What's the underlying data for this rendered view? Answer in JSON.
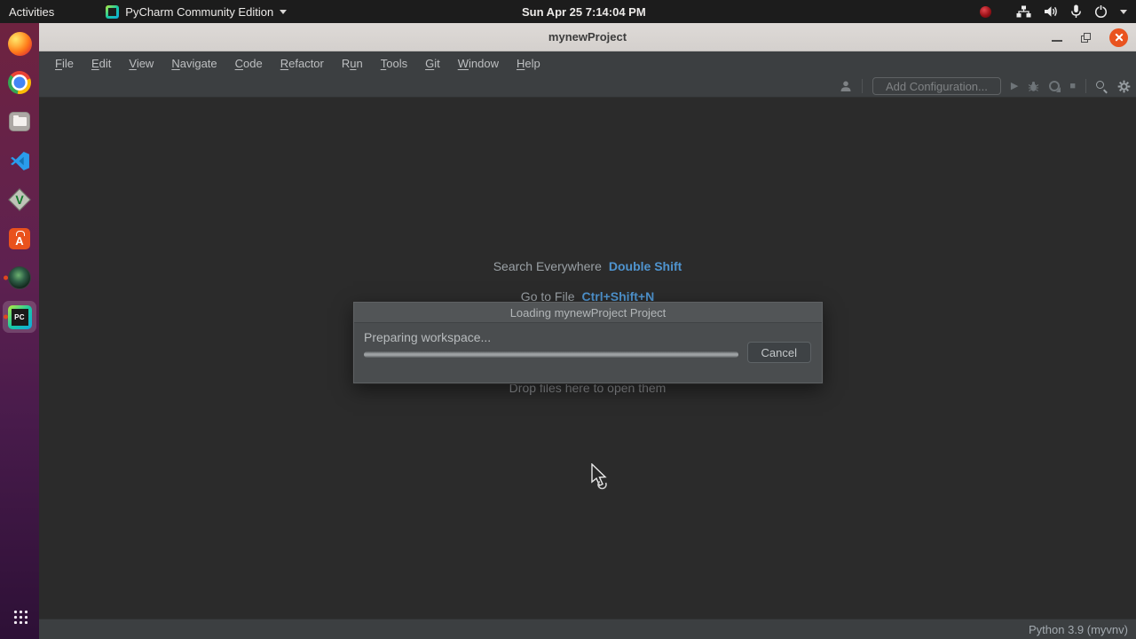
{
  "topbar": {
    "activities": "Activities",
    "app_name": "PyCharm Community Edition",
    "clock": "Sun Apr 25  7:14:04 PM"
  },
  "window": {
    "title": "mynewProject"
  },
  "menubar": {
    "items": [
      {
        "label": "File",
        "mnemonic": 0
      },
      {
        "label": "Edit",
        "mnemonic": 0
      },
      {
        "label": "View",
        "mnemonic": 0
      },
      {
        "label": "Navigate",
        "mnemonic": 0
      },
      {
        "label": "Code",
        "mnemonic": 0
      },
      {
        "label": "Refactor",
        "mnemonic": 0
      },
      {
        "label": "Run",
        "mnemonic": 1
      },
      {
        "label": "Tools",
        "mnemonic": 0
      },
      {
        "label": "Git",
        "mnemonic": 0
      },
      {
        "label": "Window",
        "mnemonic": 0
      },
      {
        "label": "Help",
        "mnemonic": 0
      }
    ]
  },
  "toolbar": {
    "add_configuration": "Add Configuration..."
  },
  "hints": {
    "search_label": "Search Everywhere",
    "search_shortcut": "Double Shift",
    "goto_label": "Go to File",
    "goto_shortcut": "Ctrl+Shift+N",
    "drop_label": "Drop files here to open them"
  },
  "dialog": {
    "title": "Loading mynewProject Project",
    "message": "Preparing workspace...",
    "cancel_label": "Cancel",
    "progress": {
      "indeterminate": true
    }
  },
  "statusbar": {
    "interpreter": "Python 3.9 (myvnv)"
  },
  "dock": {
    "items": [
      "firefox",
      "chrome",
      "files",
      "vscode",
      "vim",
      "ubuntu-software",
      "screen-recorder",
      "pycharm",
      "show-applications"
    ],
    "running": [
      "screen-recorder",
      "pycharm"
    ],
    "active": "pycharm",
    "pycharm_badge": "PC"
  },
  "icons": {
    "tray": [
      "recording-indicator",
      "network",
      "volume",
      "microphone",
      "power",
      "menu-caret"
    ],
    "toolbar": [
      "user",
      "add-configuration",
      "run-play",
      "debug-bug",
      "profiler",
      "stop-square",
      "search-magnifier",
      "settings-gear"
    ],
    "window_controls": [
      "minimize",
      "maximize-restore",
      "close"
    ]
  },
  "colors": {
    "close_button": "#e9531f",
    "shortcut_blue": "#4f94cf",
    "panel_bg": "#3c3f41",
    "editor_bg": "#2b2b2b",
    "dialog_bg": "#4a4d4f",
    "titlebar_bg": "#d5d1ce",
    "topbar_bg": "#1c1c1c",
    "running_dot": "#e0461e",
    "dock_gradient_top": "#6e2340",
    "dock_gradient_bottom": "#2d1036"
  }
}
